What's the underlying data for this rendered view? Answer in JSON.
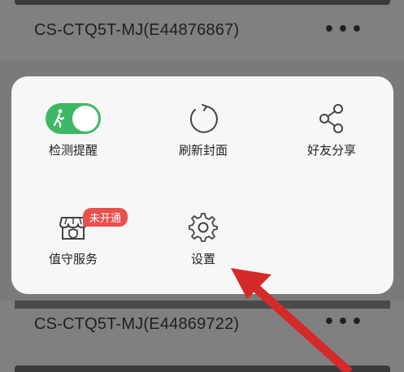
{
  "devices": [
    {
      "name": "CS-CTQ5T-MJ(E44876867)",
      "more": "•••"
    },
    {
      "name": "CS-CTQ5T-MJ(E44869722)",
      "more": "•••"
    }
  ],
  "menu": {
    "items": [
      {
        "label": "检测提醒",
        "icon": "toggle-on-icon",
        "state": "on"
      },
      {
        "label": "刷新封面",
        "icon": "refresh-icon"
      },
      {
        "label": "好友分享",
        "icon": "share-icon"
      },
      {
        "label": "值守服务",
        "icon": "store-icon",
        "badge": "未开通"
      },
      {
        "label": "设置",
        "icon": "gear-icon"
      }
    ]
  },
  "colors": {
    "toggle": "#3fb865",
    "badge": "#e8504d",
    "arrow": "#d42a2a"
  }
}
